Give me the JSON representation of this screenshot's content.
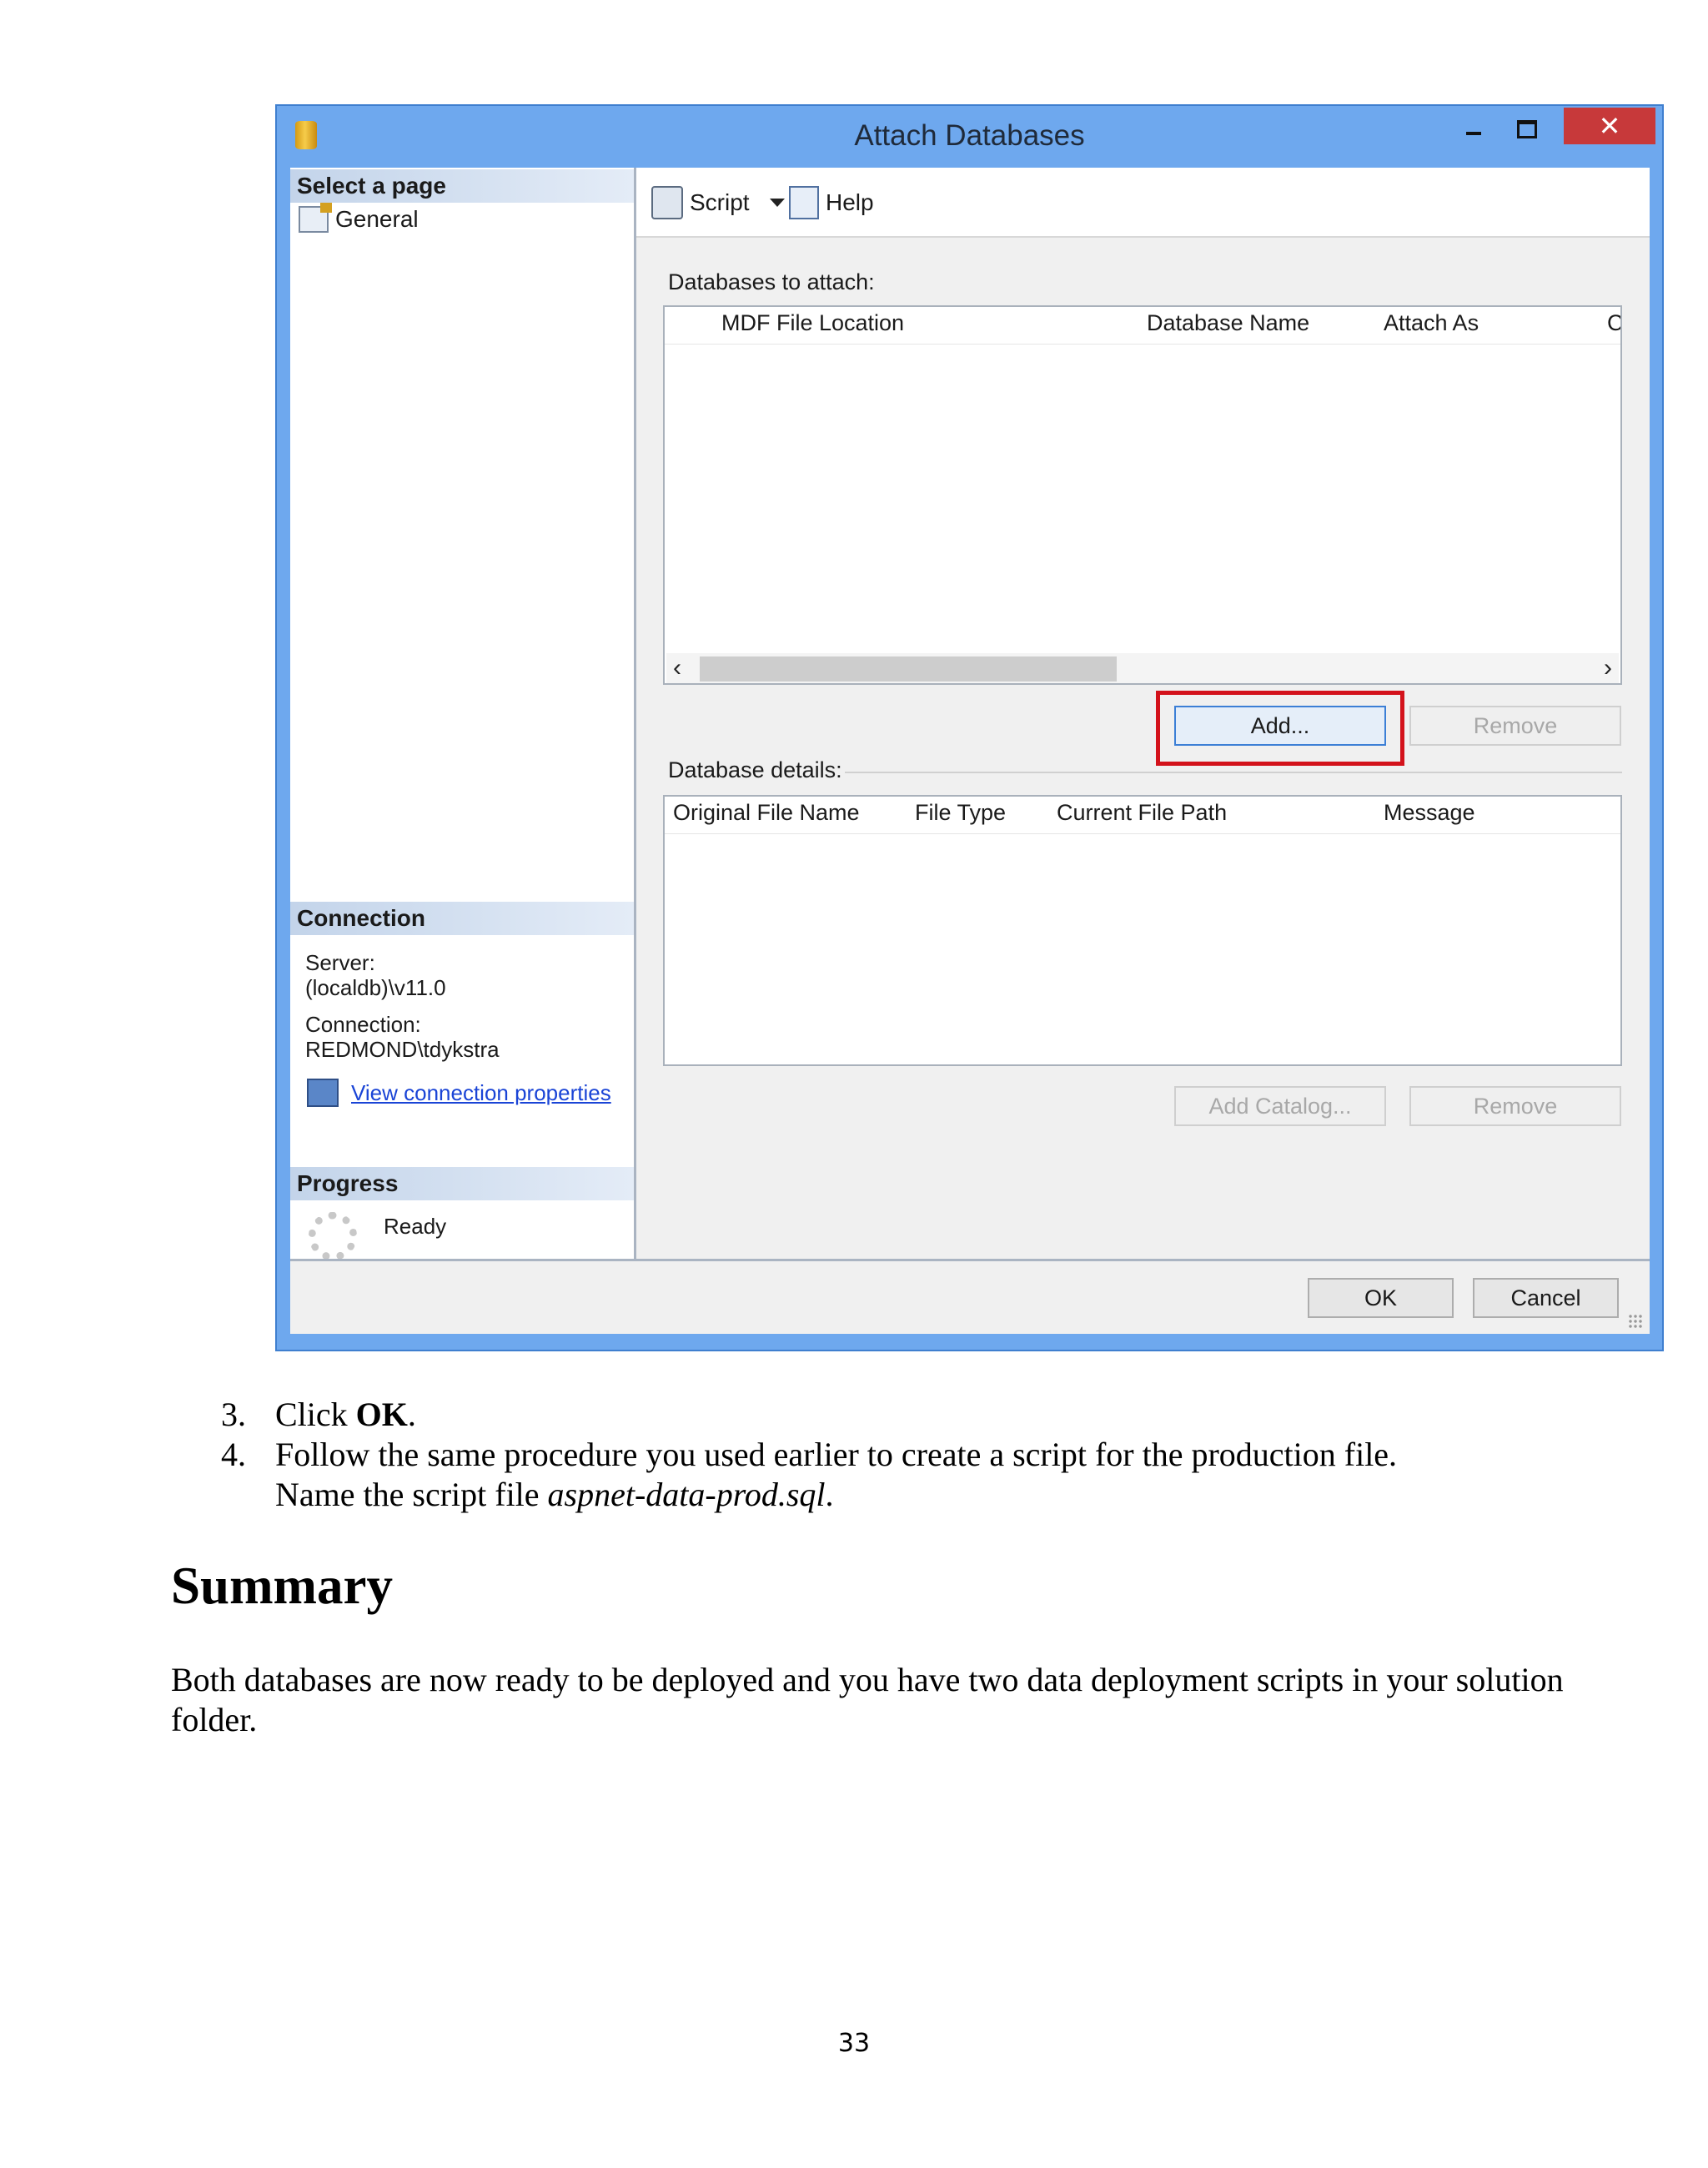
{
  "dialog": {
    "title": "Attach Databases",
    "close_glyph": "✕",
    "left_pane": {
      "select_page_header": "Select a page",
      "pages": [
        {
          "label": "General"
        }
      ],
      "connection_header": "Connection",
      "server_label": "Server:",
      "server_value": "(localdb)\\v11.0",
      "connection_label": "Connection:",
      "connection_value": "REDMOND\\tdykstra",
      "view_connection_link": "View connection properties",
      "progress_header": "Progress",
      "progress_status": "Ready"
    },
    "toolbar": {
      "script_label": "Script",
      "help_label": "Help"
    },
    "databases_to_attach": {
      "label": "Databases to attach:",
      "columns": [
        "MDF File Location",
        "Database Name",
        "Attach As",
        "C"
      ],
      "scroll_left": "‹",
      "scroll_right": "›",
      "add_button": "Add...",
      "remove_button": "Remove"
    },
    "database_details": {
      "label": "Database details:",
      "columns": [
        "Original File Name",
        "File Type",
        "Current File Path",
        "Message"
      ],
      "add_catalog_button": "Add Catalog...",
      "remove_button": "Remove"
    },
    "footer": {
      "ok_button": "OK",
      "cancel_button": "Cancel"
    }
  },
  "steps": [
    {
      "number": "3.",
      "text_prefix": "Click ",
      "text_bold": "OK",
      "text_suffix": "."
    },
    {
      "number": "4.",
      "line1": "Follow the same procedure you used earlier to create a script for the production file.",
      "line2_prefix": "Name the script file ",
      "line2_italic": "aspnet-data-prod.sql",
      "line2_suffix": "."
    }
  ],
  "summary_heading": "Summary",
  "summary_text": "Both databases are now ready to be deployed and you have two data deployment scripts in your solution folder.",
  "page_number": "33"
}
